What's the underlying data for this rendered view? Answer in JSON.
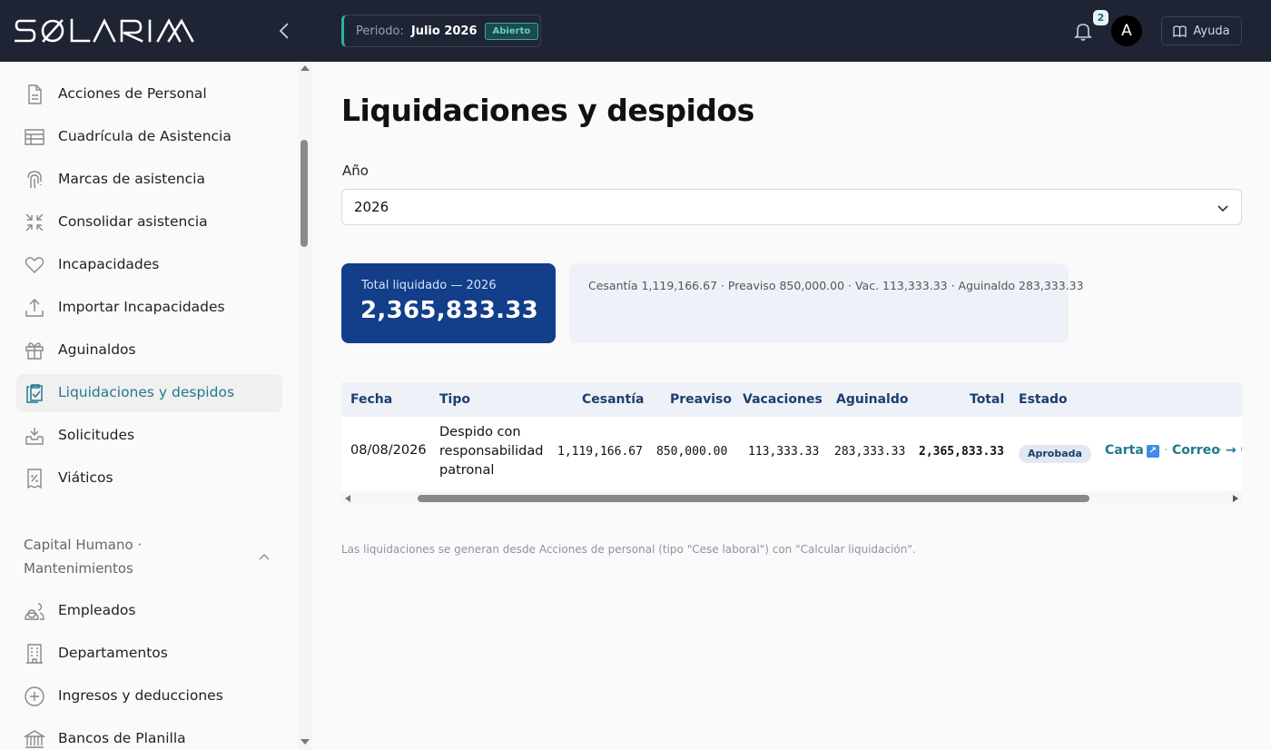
{
  "header": {
    "logo_text": "SOLARIA",
    "period_label": "Periodo:",
    "period_value": "Julio 2026",
    "period_status": "Abierto",
    "notification_count": "2",
    "avatar_initial": "A",
    "help_label": "Ayuda"
  },
  "sidebar": {
    "items": [
      {
        "label": "Acciones de Personal",
        "icon": "document-icon"
      },
      {
        "label": "Cuadrícula de Asistencia",
        "icon": "table-grid-icon"
      },
      {
        "label": "Marcas de asistencia",
        "icon": "fingerprint-icon"
      },
      {
        "label": "Consolidar asistencia",
        "icon": "compress-arrows-icon"
      },
      {
        "label": "Incapacidades",
        "icon": "heart-icon"
      },
      {
        "label": "Importar Incapacidades",
        "icon": "upload-icon"
      },
      {
        "label": "Aguinaldos",
        "icon": "gift-icon"
      },
      {
        "label": "Liquidaciones y despidos",
        "icon": "clipboard-check-icon",
        "active": true
      },
      {
        "label": "Solicitudes",
        "icon": "inbox-icon"
      },
      {
        "label": "Viáticos",
        "icon": "percent-receipt-icon"
      }
    ],
    "section_title_line1": "Capital Humano ·",
    "section_title_line2": "Mantenimientos",
    "section_items": [
      {
        "label": "Empleados",
        "icon": "users-icon"
      },
      {
        "label": "Departamentos",
        "icon": "building-icon"
      },
      {
        "label": "Ingresos y deducciones",
        "icon": "plus-circle-icon"
      },
      {
        "label": "Bancos de Planilla",
        "icon": "bank-icon"
      }
    ]
  },
  "main": {
    "title": "Liquidaciones y despidos",
    "year_label": "Año",
    "year_value": "2026",
    "total_card_label": "Total liquidado — 2026",
    "total_card_value": "2,365,833.33",
    "breakdown_text": "Cesantía 1,119,166.67 · Preaviso 850,000.00 · Vac. 113,333.33 · Aguinaldo 283,333.33",
    "table": {
      "headers": [
        "Fecha",
        "Tipo",
        "Cesantía",
        "Preaviso",
        "Vacaciones",
        "Aguinaldo",
        "Total",
        "Estado"
      ],
      "row": {
        "fecha": "08/08/2026",
        "tipo_line1": "Despido con",
        "tipo_line2": "responsabilidad",
        "tipo_line3": "patronal",
        "cesantia": "1,119,166.67",
        "preaviso": "850,000.00",
        "vacaciones": "113,333.33",
        "aguinaldo": "283,333.33",
        "total": "2,365,833.33",
        "estado": "Aprobada",
        "link_carta": "Carta",
        "link_carta_icon": "↗",
        "link_correo": "Correo",
        "link_more": "→ C"
      }
    },
    "footnote": "Las liquidaciones se generan desde Acciones de personal (tipo \"Cese laboral\") con \"Calcular liquidación\"."
  },
  "colors": {
    "topbar": "#1e2433",
    "accent_teal": "#1f7a8c",
    "card_blue": "#123e8a",
    "header_text": "#1d3e6e"
  }
}
